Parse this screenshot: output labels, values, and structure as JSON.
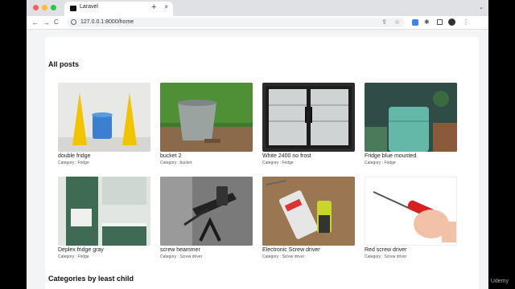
{
  "browser": {
    "tab_title": "Laravel",
    "new_tab": "+",
    "tab_close": "×",
    "url": "127.0.0.1:8000/home",
    "back": "←",
    "forward": "→",
    "reload": "C"
  },
  "page": {
    "heading": "All posts",
    "section2_heading": "Categories by least child",
    "posts": [
      {
        "title": "double fridge",
        "category": "Category : Fridge"
      },
      {
        "title": "bucket 2",
        "category": "Category : bucket"
      },
      {
        "title": "White 2400 no frost",
        "category": "Category : Fridge"
      },
      {
        "title": "Fridge blue mounted",
        "category": "Category : Fridge"
      },
      {
        "title": "Deplex fridge gray",
        "category": "Category : Fridge"
      },
      {
        "title": "screw heammer",
        "category": "Category : Screw driver"
      },
      {
        "title": "Electronic Screw driver",
        "category": "Category : Screw driver"
      },
      {
        "title": "Red screw driver",
        "category": "Category : Screw driver"
      }
    ]
  },
  "watermark": "Udemy"
}
